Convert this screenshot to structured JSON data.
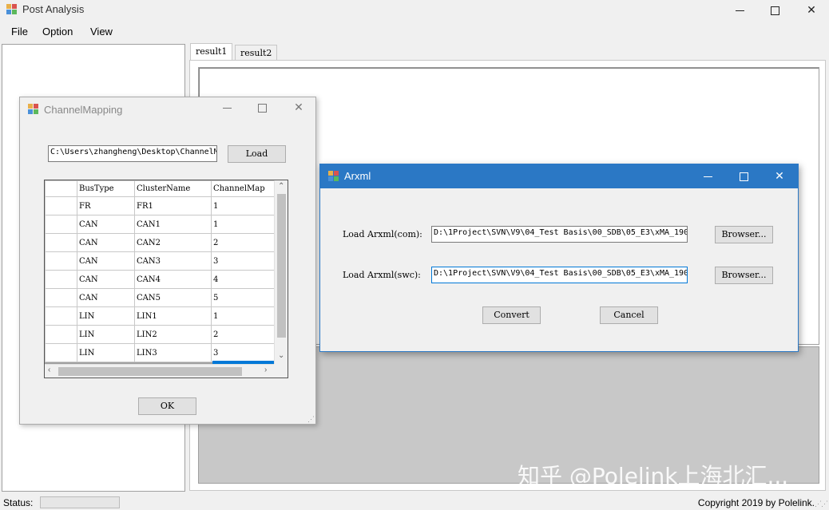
{
  "main_window": {
    "title": "Post Analysis",
    "menu": [
      "File",
      "Option",
      "View"
    ],
    "tabs": [
      "result1",
      "result2"
    ],
    "status_label": "Status:",
    "copyright": "Copyright 2019 by Polelink."
  },
  "channel_mapping": {
    "title": "ChannelMapping",
    "path_value": "C:\\Users\\zhangheng\\Desktop\\ChannelM",
    "load_label": "Load",
    "ok_label": "OK",
    "columns": [
      "",
      "BusType",
      "ClusterName",
      "ChannelMap"
    ],
    "rows": [
      [
        "",
        "FR",
        "FR1",
        "1"
      ],
      [
        "",
        "CAN",
        "CAN1",
        "1"
      ],
      [
        "",
        "CAN",
        "CAN2",
        "2"
      ],
      [
        "",
        "CAN",
        "CAN3",
        "3"
      ],
      [
        "",
        "CAN",
        "CAN4",
        "4"
      ],
      [
        "",
        "CAN",
        "CAN5",
        "5"
      ],
      [
        "",
        "LIN",
        "LIN1",
        "1"
      ],
      [
        "",
        "LIN",
        "LIN2",
        "2"
      ],
      [
        "",
        "LIN",
        "LIN3",
        "3"
      ]
    ]
  },
  "arxml": {
    "title": "Arxml",
    "com_label": "Load Arxml(com):",
    "com_value": "D:\\1Project\\SVN\\V9\\04_Test Basis\\00_SDB\\05_E3\\xMA_190",
    "swc_label": "Load Arxml(swc):",
    "swc_value": "D:\\1Project\\SVN\\V9\\04_Test Basis\\00_SDB\\05_E3\\xMA_190",
    "browse_label": "Browser...",
    "convert_label": "Convert",
    "cancel_label": "Cancel",
    "accent_color": "#2b78c5"
  },
  "watermark": "知乎 @Polelink上海北汇..."
}
